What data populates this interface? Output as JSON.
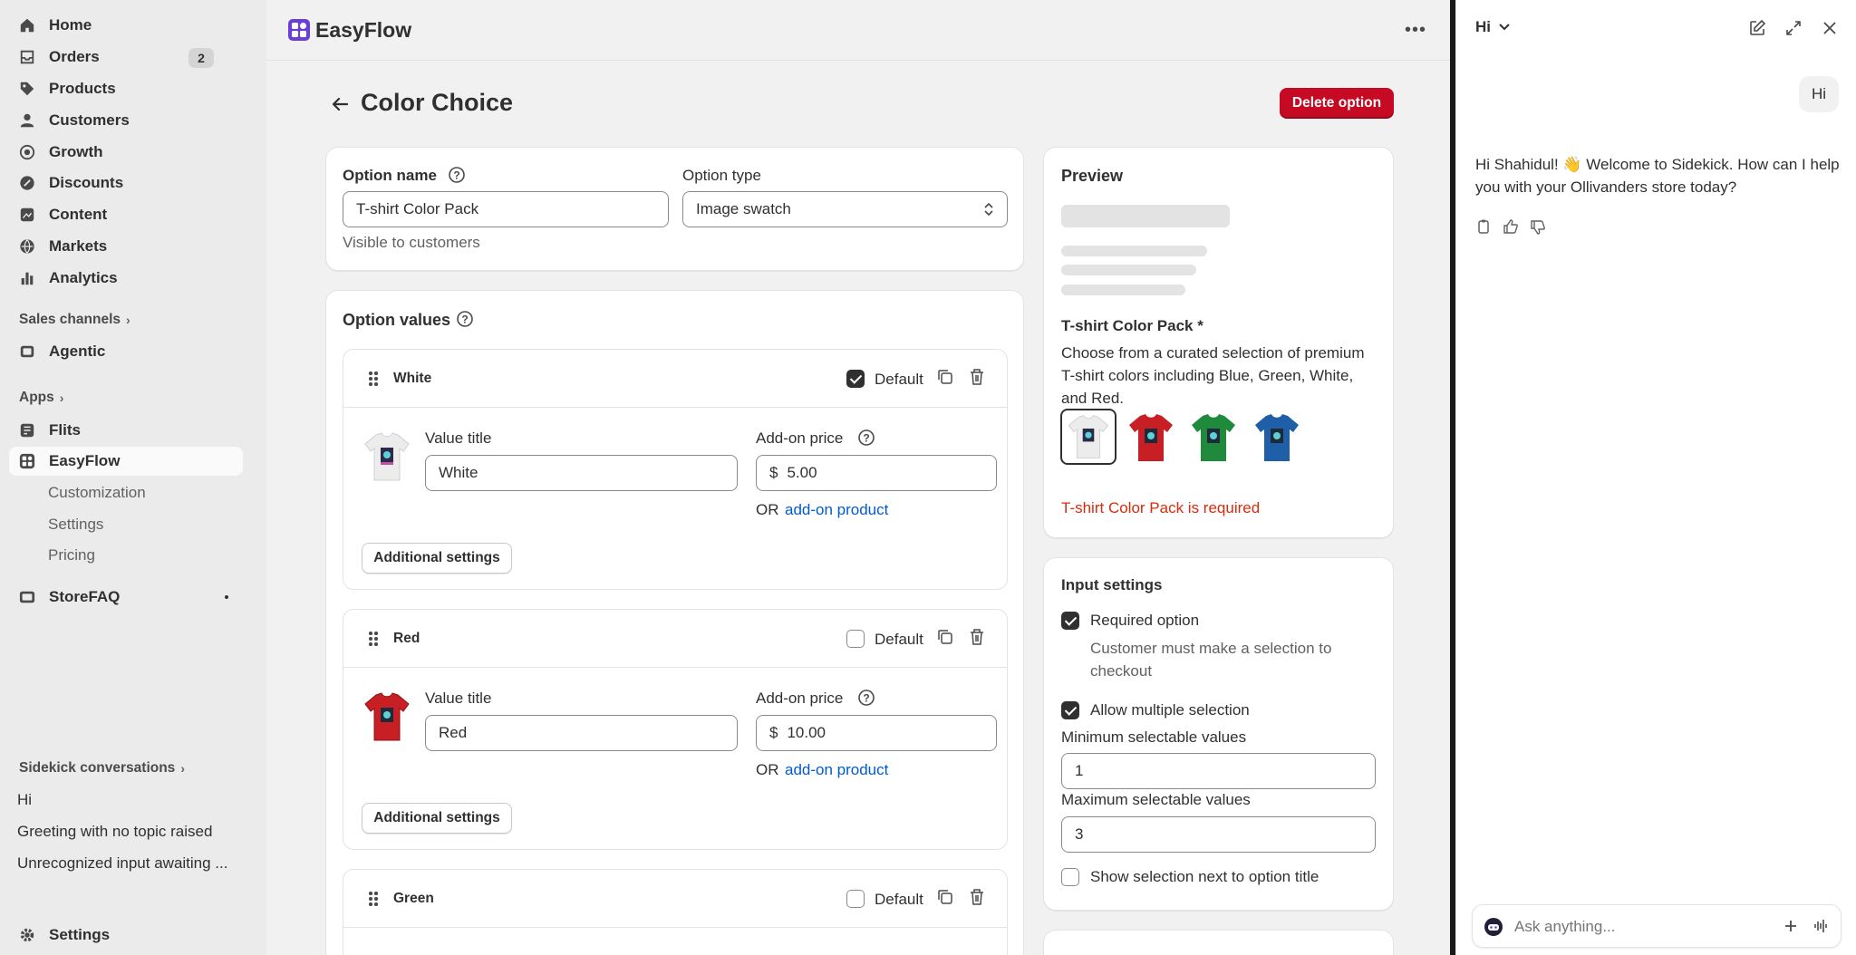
{
  "sidebar": {
    "nav": [
      {
        "label": "Home",
        "icon": "home-icon"
      },
      {
        "label": "Orders",
        "icon": "orders-icon",
        "badge": "2"
      },
      {
        "label": "Products",
        "icon": "tag-icon"
      },
      {
        "label": "Customers",
        "icon": "person-icon"
      },
      {
        "label": "Growth",
        "icon": "growth-icon"
      },
      {
        "label": "Discounts",
        "icon": "discount-icon"
      },
      {
        "label": "Content",
        "icon": "content-icon"
      },
      {
        "label": "Markets",
        "icon": "globe-icon"
      },
      {
        "label": "Analytics",
        "icon": "chart-bar-icon"
      }
    ],
    "sales_channels_label": "Sales channels",
    "agentic_label": "Agentic",
    "apps_label": "Apps",
    "apps": {
      "flits": "Flits",
      "easyflow": "EasyFlow",
      "easyflow_sub": [
        "Customization",
        "Settings",
        "Pricing"
      ],
      "storefaq": "StoreFAQ"
    },
    "sidekick_label": "Sidekick conversations",
    "conversations": [
      "Hi",
      "Greeting with no topic raised",
      "Unrecognized input awaiting ..."
    ],
    "settings_label": "Settings"
  },
  "header": {
    "app_name": "EasyFlow",
    "more_icon": "ellipsis-icon"
  },
  "page": {
    "title": "Color Choice",
    "delete_label": "Delete option"
  },
  "option": {
    "name_label": "Option name",
    "name_value": "T-shirt Color Pack",
    "type_label": "Option type",
    "type_value": "Image swatch",
    "visible_note": "Visible to customers"
  },
  "values_section": {
    "title": "Option values",
    "default_label": "Default",
    "value_title_label": "Value title",
    "addon_label": "Add-on price",
    "or_label": "OR",
    "addon_product_label": "add-on product",
    "additional_label": "Additional settings",
    "currency": "$",
    "items": [
      {
        "name": "White",
        "title": "White",
        "price": "5.00",
        "default": true,
        "color": "#f2f2f2"
      },
      {
        "name": "Red",
        "title": "Red",
        "price": "10.00",
        "default": false,
        "color": "#c81f25"
      },
      {
        "name": "Green",
        "title": "",
        "price": "",
        "default": false,
        "color": "#1f8a3c"
      }
    ]
  },
  "preview": {
    "title": "Preview",
    "option_title": "T-shirt Color Pack *",
    "description": "Choose from a curated selection of premium T-shirt colors including Blue, Green, White, and Red.",
    "swatches": [
      {
        "name": "White",
        "color": "#f2f2f2",
        "selected": true
      },
      {
        "name": "Red",
        "color": "#c81f25",
        "selected": false
      },
      {
        "name": "Green",
        "color": "#1f8a3c",
        "selected": false
      },
      {
        "name": "Blue",
        "color": "#1f5fa8",
        "selected": false
      }
    ],
    "error": "T-shirt Color Pack is required"
  },
  "input_settings": {
    "title": "Input settings",
    "required_label": "Required option",
    "required_help": "Customer must make a selection to checkout",
    "multiple_label": "Allow multiple selection",
    "min_label": "Minimum selectable values",
    "min_value": "1",
    "max_label": "Maximum selectable values",
    "max_value": "3",
    "show_selection_label": "Show selection next to option title"
  },
  "sidekick": {
    "title": "Hi",
    "user_message": "Hi",
    "assistant_message": "Hi Shahidul! 👋 Welcome to Sidekick. How can I help you with your Ollivanders store today?",
    "input_placeholder": "Ask anything..."
  },
  "colors": {
    "accent_red": "#c70a24",
    "error_red": "#d72c0d",
    "link_blue": "#005bd3"
  }
}
